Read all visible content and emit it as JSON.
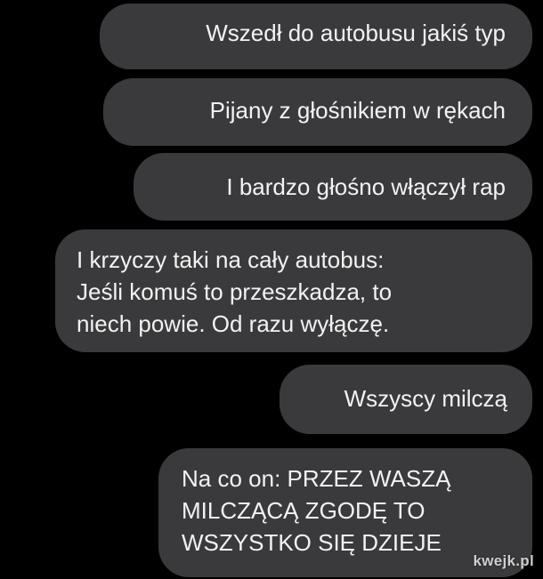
{
  "messages": [
    {
      "text": "Wszedł do autobusu jakiś typ"
    },
    {
      "text": "Pijany z głośnikiem w rękach"
    },
    {
      "text": "I bardzo głośno włączył rap"
    },
    {
      "text": "I krzyczy taki na cały autobus:\nJeśli komuś to przeszkadza, to\nniech powie. Od razu wyłączę."
    },
    {
      "text": "Wszyscy milczą"
    },
    {
      "text": "Na co on: PRZEZ WASZĄ\nMILCZĄCĄ ZGODĘ TO\nWSZYSTKO SIĘ DZIEJE"
    }
  ],
  "watermark": "kwejk.pl",
  "colors": {
    "background": "#000000",
    "bubble": "#3a3a3c",
    "text": "#f2f2f2"
  }
}
